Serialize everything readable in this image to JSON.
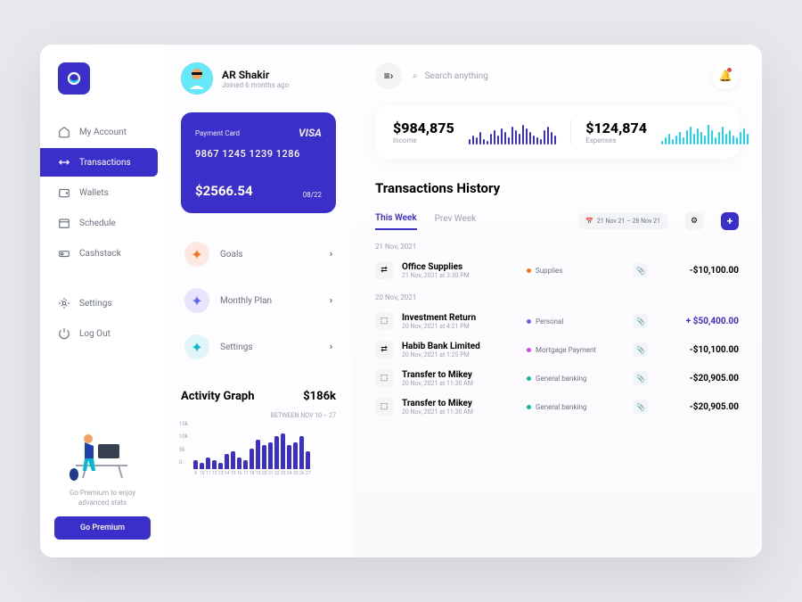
{
  "sidebar": {
    "nav": [
      {
        "icon": "home",
        "label": "My Account"
      },
      {
        "icon": "swap",
        "label": "Transactions"
      },
      {
        "icon": "wallet",
        "label": "Wallets"
      },
      {
        "icon": "calendar",
        "label": "Schedule"
      },
      {
        "icon": "stack",
        "label": "Cashstack"
      }
    ],
    "bottom": [
      {
        "icon": "gear",
        "label": "Settings"
      },
      {
        "icon": "power",
        "label": "Log Out"
      }
    ],
    "premium_text": "Go Premium to enjoy advanced stats",
    "premium_btn": "Go Premium"
  },
  "profile": {
    "name": "AR Shakir",
    "joined": "Joined 6 months ago"
  },
  "card": {
    "label": "Payment Card",
    "brand": "VISA",
    "number": "9867 1245 1239 1286",
    "balance": "$2566.54",
    "expiry": "08/22"
  },
  "quick": [
    {
      "label": "Goals",
      "bg": "#fde8e4",
      "color": "#f97316"
    },
    {
      "label": "Monthly Plan",
      "bg": "#e8e4fd",
      "color": "#6366f1"
    },
    {
      "label": "Settings",
      "bg": "#e0f5f7",
      "color": "#06b6d4"
    }
  ],
  "activity": {
    "title": "Activity Graph",
    "value": "$186k",
    "range": "BETWEEN NOV 10 – 27"
  },
  "chart_data": {
    "type": "bar",
    "categories": [
      "9",
      "10",
      "11",
      "12",
      "13",
      "14",
      "15",
      "16",
      "17",
      "18",
      "19",
      "20",
      "21",
      "22",
      "23",
      "24",
      "25",
      "26",
      "27"
    ],
    "values": [
      3,
      2,
      4,
      3,
      2,
      5,
      6,
      4,
      3,
      7,
      10,
      8,
      9,
      11,
      12,
      8,
      9,
      11,
      6
    ],
    "ylim": [
      0,
      15
    ],
    "yticks": [
      "15k",
      "10k",
      "5k",
      "0"
    ],
    "xlabel": "",
    "ylabel": ""
  },
  "search": {
    "placeholder": "Search anything"
  },
  "stats": {
    "income": {
      "value": "$984,875",
      "label": "Income",
      "color": "#3b2fc9",
      "heights": [
        6,
        10,
        8,
        14,
        6,
        4,
        12,
        16,
        10,
        18,
        14,
        8,
        20,
        16,
        12,
        22,
        18,
        14,
        10,
        8,
        6,
        16,
        20,
        14,
        10
      ]
    },
    "expenses": {
      "value": "$124,874",
      "label": "Expenses",
      "color": "#22d3ee",
      "heights": [
        4,
        8,
        12,
        6,
        10,
        14,
        8,
        16,
        20,
        12,
        18,
        14,
        10,
        22,
        16,
        8,
        14,
        20,
        12,
        16,
        10,
        8,
        14,
        18,
        12
      ]
    }
  },
  "history": {
    "title": "Transactions History",
    "tabs": [
      "This Week",
      "Prev Week"
    ],
    "date_range": "21 Nov 21 – 28 Nov 21",
    "groups": [
      {
        "date": "21 Nov, 2021",
        "items": [
          {
            "icon": "⇄",
            "title": "Office Supplies",
            "sub": "21 Nov, 2021 at 3:30 PM",
            "cat": "Supplies",
            "dot": "#f97316",
            "amount": "-$10,100.00",
            "positive": false
          }
        ]
      },
      {
        "date": "20 Nov, 2021",
        "items": [
          {
            "icon": "⬚",
            "title": "Investment Return",
            "sub": "20 Nov, 2021 at 4:21 PM",
            "cat": "Personal",
            "dot": "#6366f1",
            "amount": "+ $50,400.00",
            "positive": true
          },
          {
            "icon": "⇄",
            "title": "Habib Bank Limited",
            "sub": "20 Nov, 2021 at 1:25 PM",
            "cat": "Mortgage Payment",
            "dot": "#d946ef",
            "amount": "-$10,100.00",
            "positive": false
          },
          {
            "icon": "⬚",
            "title": "Transfer to Mikey",
            "sub": "20 Nov, 2021 at 11:30 AM",
            "cat": "General banking",
            "dot": "#14b8a6",
            "amount": "-$20,905.00",
            "positive": false
          },
          {
            "icon": "⬚",
            "title": "Transfer to Mikey",
            "sub": "20 Nov, 2021 at 11:30 AM",
            "cat": "General banking",
            "dot": "#14b8a6",
            "amount": "-$20,905.00",
            "positive": false
          }
        ]
      }
    ]
  }
}
